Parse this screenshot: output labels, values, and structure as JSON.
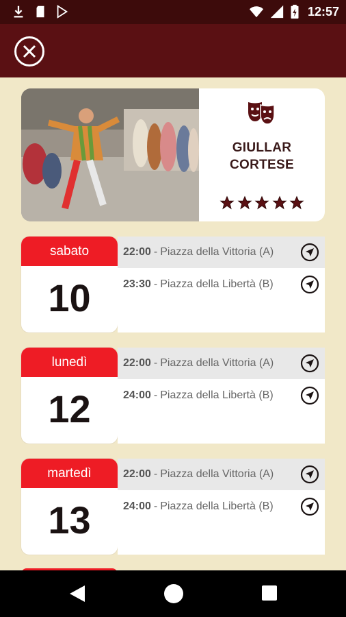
{
  "status_bar": {
    "time": "12:57",
    "icons": [
      "download-icon",
      "sd-card-icon",
      "play-store-icon",
      "wifi-icon",
      "signal-icon",
      "battery-charging-icon"
    ]
  },
  "app_bar": {
    "close_icon": "close-circle-icon"
  },
  "performer": {
    "name_line1": "GIULLAR",
    "name_line2": "CORTESE",
    "category_icon": "theater-masks-icon",
    "rating": 5,
    "rating_max": 5
  },
  "days": [
    {
      "weekday": "sabato",
      "day": "10",
      "slots": [
        {
          "time": "22:00",
          "place": "Piazza della Vittoria (A)"
        },
        {
          "time": "23:30",
          "place": "Piazza della Libertà (B)"
        }
      ]
    },
    {
      "weekday": "lunedì",
      "day": "12",
      "slots": [
        {
          "time": "22:00",
          "place": "Piazza della Vittoria (A)"
        },
        {
          "time": "24:00",
          "place": "Piazza della Libertà (B)"
        }
      ]
    },
    {
      "weekday": "martedì",
      "day": "13",
      "slots": [
        {
          "time": "22:00",
          "place": "Piazza della Vittoria (A)"
        },
        {
          "time": "24:00",
          "place": "Piazza della Libertà (B)"
        }
      ]
    }
  ],
  "separator": "-",
  "colors": {
    "status_bar": "#3d0b0b",
    "app_bar": "#5a1013",
    "background": "#f1e8c8",
    "calendar_header": "#ee1c25",
    "stars": "#5a1013"
  }
}
